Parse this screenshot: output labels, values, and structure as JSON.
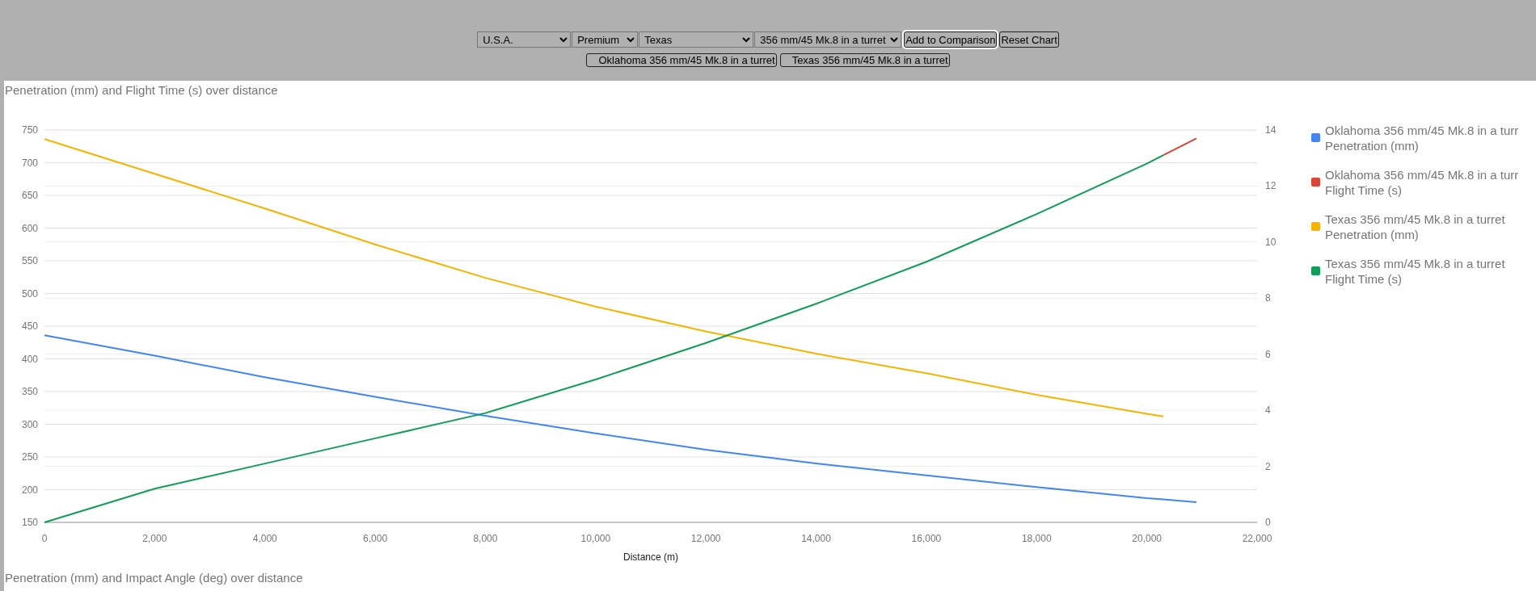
{
  "controls": {
    "selects": [
      {
        "value": "U.S.A."
      },
      {
        "value": "Premium"
      },
      {
        "value": "Texas"
      },
      {
        "value": "356 mm/45 Mk.8 in a turret"
      }
    ],
    "buttons": [
      {
        "label": "Add to Comparison",
        "focused": true
      },
      {
        "label": "Reset Chart",
        "focused": false
      }
    ]
  },
  "comparison": [
    "Oklahoma 356 mm/45 Mk.8 in a turret",
    "Texas 356 mm/45 Mk.8 in a turret"
  ],
  "charts": [
    {
      "title": "Penetration (mm) and Flight Time (s) over distance",
      "chart_data": {
        "type": "line",
        "xlabel": "Distance (m)",
        "x": [
          0,
          2000,
          4000,
          6000,
          8000,
          10000,
          12000,
          14000,
          16000,
          18000,
          20000,
          20300,
          20900
        ],
        "xlim": [
          0,
          22000
        ],
        "xticks": [
          {
            "value": 0,
            "label": "0"
          },
          {
            "value": 2000,
            "label": "2,000"
          },
          {
            "value": 4000,
            "label": "4,000"
          },
          {
            "value": 6000,
            "label": "6,000"
          },
          {
            "value": 8000,
            "label": "8,000"
          },
          {
            "value": 10000,
            "label": "10,000"
          },
          {
            "value": 12000,
            "label": "12,000"
          },
          {
            "value": 14000,
            "label": "14,000"
          },
          {
            "value": 16000,
            "label": "16,000"
          },
          {
            "value": 18000,
            "label": "18,000"
          },
          {
            "value": 20000,
            "label": "20,000"
          },
          {
            "value": 22000,
            "label": "22,000"
          }
        ],
        "ylim": [
          150,
          750
        ],
        "yticks": [
          150,
          200,
          250,
          300,
          350,
          400,
          450,
          500,
          550,
          600,
          650,
          700,
          750
        ],
        "grid": true,
        "y2lim": [
          0,
          14
        ],
        "y2ticks": [
          0,
          2,
          4,
          6,
          8,
          10,
          12,
          14
        ],
        "series": [
          {
            "name": "Oklahoma 356 mm/45 Mk.8 in a turr Penetration (mm)",
            "color": "#4285f4",
            "values": [
              436,
              405,
              372,
              342,
              313,
              286,
              261,
              240,
              222,
              204,
              187,
              185,
              181
            ]
          },
          {
            "name": "Oklahoma 356 mm/45 Mk.8 in a turr Flight Time (s)",
            "axis": "y2",
            "color": "#db4437",
            "values": [
              null,
              null,
              null,
              null,
              null,
              null,
              null,
              null,
              null,
              null,
              null,
              13.1,
              13.7
            ]
          },
          {
            "name": "Texas 356 mm/45 Mk.8 in a turret Penetration (mm)",
            "color": "#f4b400",
            "values": [
              736,
              683,
              630,
              575,
              524,
              480,
              442,
              408,
              378,
              345,
              316,
              312,
              null
            ]
          },
          {
            "name": "Texas 356 mm/45 Mk.8 in a turret Flight Time (s)",
            "axis": "y2",
            "color": "#0f9d58",
            "values": [
              0,
              1.2,
              2.1,
              3,
              3.9,
              5.1,
              6.4,
              7.8,
              9.3,
              11,
              12.8,
              13.1,
              null
            ]
          }
        ]
      }
    },
    {
      "title": "Penetration (mm) and Impact Angle (deg) over distance"
    }
  ]
}
